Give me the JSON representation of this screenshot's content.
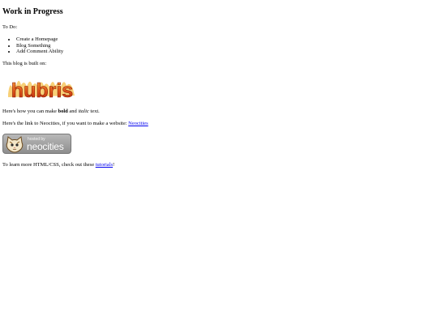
{
  "title": "Work in Progress",
  "todo_label": "To Do:",
  "todo_items": [
    "Create a Homepage",
    "Blog Something",
    "Add Comment Ability"
  ],
  "built_on_label": "This blog is built on:",
  "logo_text": "hubris",
  "formatting": {
    "prefix": "Here's how you can make ",
    "bold": "bold",
    "middle": " and ",
    "italic": "italic",
    "suffix": " text."
  },
  "neocities_line": {
    "text": "Here's the link to Neocities, if you want to make a website: ",
    "link": "Neocities"
  },
  "badge": {
    "small": "hosted by",
    "big": "neocities"
  },
  "learn_line": {
    "text": "To learn more HTML/CSS, check out these ",
    "link": "tutorials",
    "suffix": "!"
  },
  "colors": {
    "link": "#0000ee",
    "logo_fire": "#d9480f"
  }
}
